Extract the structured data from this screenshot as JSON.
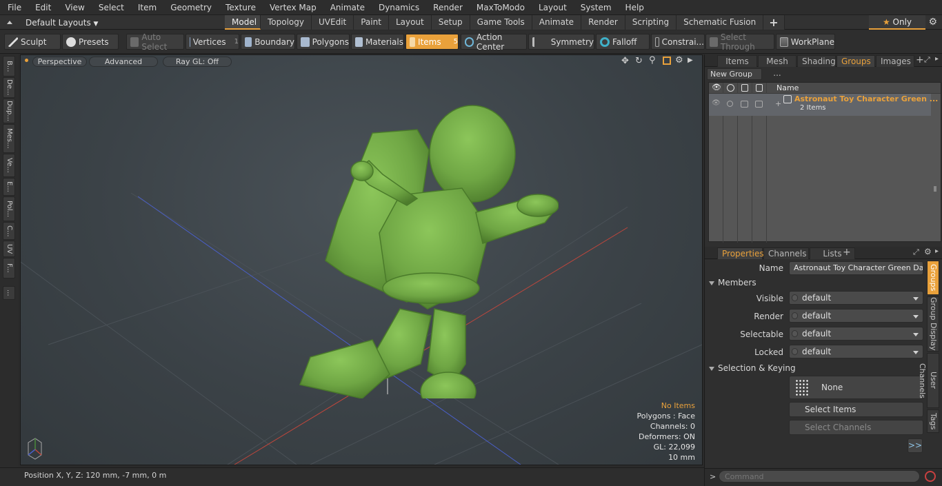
{
  "menu": [
    "File",
    "Edit",
    "View",
    "Select",
    "Item",
    "Geometry",
    "Texture",
    "Vertex Map",
    "Animate",
    "Dynamics",
    "Render",
    "MaxToModo",
    "Layout",
    "System",
    "Help"
  ],
  "layout_selector": "Default Layouts",
  "layout_tabs": [
    "Model",
    "Topology",
    "UVEdit",
    "Paint",
    "Layout",
    "Setup",
    "Game Tools",
    "Animate",
    "Render",
    "Scripting",
    "Schematic Fusion"
  ],
  "only_label": "Only",
  "toolbar": {
    "sculpt": "Sculpt",
    "presets": "Presets",
    "auto_select": "Auto Select",
    "vertices": "Vertices",
    "vertices_count": "1",
    "boundary": "Boundary",
    "polygons": "Polygons",
    "materials": "Materials",
    "items": "Items",
    "items_count": "5",
    "action_center": "Action Center",
    "symmetry": "Symmetry",
    "falloff": "Falloff",
    "constraints": "Constrai...",
    "select_through": "Select Through",
    "workplane": "WorkPlane"
  },
  "left_tabs": [
    "B...",
    "De...",
    "Dup...",
    "Mes...",
    "Ve...",
    "E...",
    "Pol...",
    "C...",
    "UV",
    "F...",
    "..."
  ],
  "viewport": {
    "view": "Perspective",
    "shading": "Advanced",
    "raygl": "Ray GL: Off",
    "info": {
      "selection": "No Items",
      "polygons": "Polygons : Face",
      "channels": "Channels: 0",
      "deformers": "Deformers: ON",
      "gl": "GL: 22,099",
      "scale": "10 mm"
    },
    "model_color": "#6fa644"
  },
  "status": "Position X, Y, Z:   120 mm, -7 mm, 0 m",
  "top_panel_tabs": [
    "Items",
    "Mesh ...",
    "Shading",
    "Groups",
    "Images"
  ],
  "top_panel_active": "Groups",
  "groups": {
    "new_group": "New Group",
    "name_col": "Name",
    "row_name": "Astronaut Toy Character Green ...",
    "row_sub": "2 Items"
  },
  "props_tabs": [
    "Properties",
    "Channels",
    "Lists"
  ],
  "props": {
    "name_label": "Name",
    "name_value": "Astronaut Toy Character Green Dancing",
    "members": "Members",
    "visible_label": "Visible",
    "visible_value": "default",
    "render_label": "Render",
    "render_value": "default",
    "selectable_label": "Selectable",
    "selectable_value": "default",
    "locked_label": "Locked",
    "locked_value": "default",
    "sel_keying": "Selection & Keying",
    "none_label": "None",
    "select_items": "Select Items",
    "select_channels": "Select Channels",
    "more": ">>"
  },
  "right_vtabs": [
    "Groups",
    "Group Display",
    "User Channels",
    "Tags"
  ],
  "command_placeholder": "Command",
  "accent": "#e9a13b"
}
